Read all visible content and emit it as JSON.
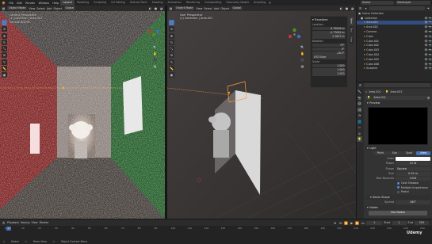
{
  "topbar": {
    "menus": [
      "File",
      "Edit",
      "Render",
      "Window",
      "Help"
    ],
    "workspaces": [
      "Layout",
      "Modeling",
      "Sculpting",
      "UV Editing",
      "Texture Paint",
      "Shading",
      "Animation",
      "Rendering",
      "Compositing",
      "Geometry Nodes",
      "Scripting"
    ],
    "active_workspace": "Layout",
    "scene": "Scene",
    "view_layer": "ViewLayer"
  },
  "left_viewport": {
    "mode": "Object Mode",
    "menus": [
      "View",
      "Select",
      "Add",
      "Object"
    ],
    "orientation": "Global",
    "options": "Options",
    "info_lines": [
      "Camera Perspective",
      "(1) Collection | Area.001",
      "Sample 8/4096"
    ]
  },
  "right_viewport": {
    "mode": "Object Mode",
    "menus": [
      "View",
      "Select",
      "Add",
      "Object"
    ],
    "orientation": "Global",
    "options": "Options",
    "info_lines": [
      "User Perspective",
      "(1) Collection | Area.001"
    ]
  },
  "npanel": {
    "header": "Transform",
    "location_label": "Location:",
    "location": {
      "x": "0.75616 m",
      "y": "-0.77692 m",
      "z": "2.1807 m"
    },
    "rotation_label": "Rotation:",
    "rotation": {
      "x": "75°",
      "y": "0°",
      "z": "-18.5°"
    },
    "mode": "XYZ Euler",
    "scale_label": "Scale:",
    "scale": {
      "x": "1.000",
      "y": "1.000",
      "z": "1.000"
    },
    "tabs": [
      "Item",
      "Tool",
      "View"
    ]
  },
  "outliner": {
    "title": "Scene Collection",
    "rows": [
      {
        "name": "Collection",
        "selected": false
      },
      {
        "name": "Area.001",
        "selected": true
      },
      {
        "name": "Area.002",
        "selected": false
      },
      {
        "name": "Camera",
        "selected": false
      },
      {
        "name": "Cube",
        "selected": false
      },
      {
        "name": "Cube.001",
        "selected": false
      },
      {
        "name": "Cube.002",
        "selected": false
      },
      {
        "name": "Cube.003",
        "selected": false
      },
      {
        "name": "Cube.004",
        "selected": false
      },
      {
        "name": "Cube.005",
        "selected": false
      },
      {
        "name": "Cube.006",
        "selected": false
      },
      {
        "name": "Suzanne",
        "selected": false
      }
    ]
  },
  "properties": {
    "object_name": "Area.001",
    "data_name": "Area.001",
    "datablock": "Area.001",
    "preview_label": "Preview",
    "light_label": "Light",
    "light_types": [
      "Point",
      "Sun",
      "Spot",
      "Area"
    ],
    "active_light_type": "Area",
    "rows": [
      {
        "label": "Color",
        "value": ""
      },
      {
        "label": "Power",
        "value": "10 W"
      },
      {
        "label": "Shape",
        "value": "Square"
      },
      {
        "label": "Size",
        "value": "0.25 m"
      },
      {
        "label": "Max Bounces",
        "value": "1024"
      }
    ],
    "checks": [
      {
        "label": "Cast Shadow",
        "on": true
      },
      {
        "label": "Multiple Importance",
        "on": true
      },
      {
        "label": "Portal",
        "on": false
      }
    ],
    "beam_shape_label": "Beam Shape",
    "spread_label": "Spread",
    "spread_value": "180°",
    "nodes_label": "Nodes",
    "use_nodes_label": "Use Nodes"
  },
  "timeline": {
    "playback": "Playback",
    "keying": "Keying",
    "view": "View",
    "marker": "Marker",
    "current_frame": "1",
    "start_label": "Start",
    "start": "1",
    "end_label": "End",
    "end": "250",
    "ticks": [
      "0",
      "10",
      "20",
      "30",
      "40",
      "50",
      "60",
      "70",
      "80",
      "90",
      "100",
      "110",
      "120",
      "130",
      "140",
      "150",
      "160",
      "170",
      "180",
      "190",
      "200",
      "210",
      "220",
      "230",
      "240",
      "250"
    ]
  },
  "statusbar": {
    "items": [
      "Select",
      "Move View",
      "Object Context Menu"
    ],
    "version": "Udemy"
  },
  "colors": {
    "accent": "#4772b3",
    "selection": "#334d80",
    "light_color": "#ffffff"
  }
}
